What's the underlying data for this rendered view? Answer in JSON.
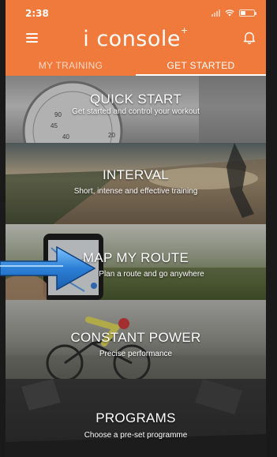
{
  "status_bar": {
    "time": "2:38",
    "battery_level": 0.4
  },
  "header": {
    "logo_text": "i console",
    "logo_sup": "+"
  },
  "tabs": [
    {
      "label": "MY TRAINING",
      "active": false
    },
    {
      "label": "GET STARTED",
      "active": true
    }
  ],
  "tiles": [
    {
      "title": "QUICK START",
      "subtitle": "Get started and control your workout"
    },
    {
      "title": "INTERVAL",
      "subtitle": "Short, intense and effective training"
    },
    {
      "title": "MAP MY ROUTE",
      "subtitle": "Plan a route and go anywhere"
    },
    {
      "title": "CONSTANT POWER",
      "subtitle": "Precise performance"
    },
    {
      "title": "PROGRAMS",
      "subtitle": "Choose a pre-set programme"
    }
  ],
  "quick_start_dial_numbers": [
    "90",
    "45",
    "40",
    "20"
  ],
  "colors": {
    "header": "#f07a3c",
    "text": "#ffffff",
    "arrow": "#2b7fd6"
  },
  "icons": [
    "menu-icon",
    "bell-icon",
    "wifi-icon",
    "battery-icon",
    "signal-icon",
    "arrow-icon"
  ]
}
